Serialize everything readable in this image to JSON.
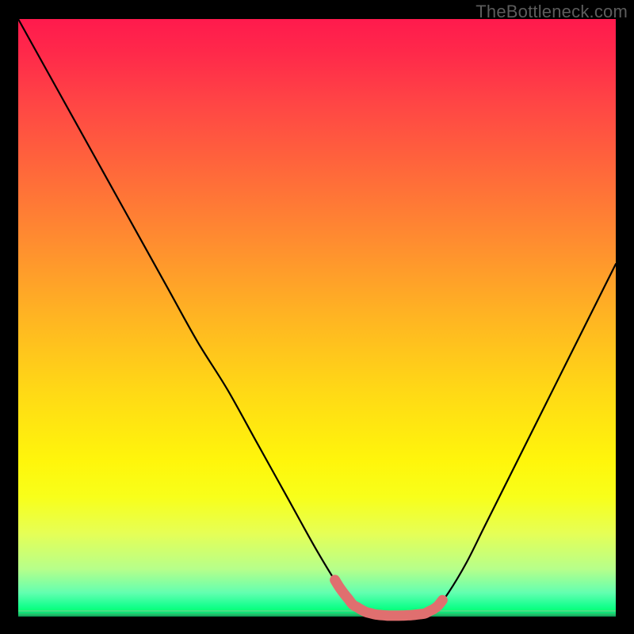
{
  "watermark": "TheBottleneck.com",
  "colors": {
    "frame": "#000000",
    "curve": "#000000",
    "highlight": "#e06f6f",
    "gradient_top": "#ff1a4d",
    "gradient_bottom": "#009e55"
  },
  "chart_data": {
    "type": "line",
    "title": "",
    "xlabel": "",
    "ylabel": "",
    "xlim": [
      0,
      100
    ],
    "ylim": [
      0,
      100
    ],
    "grid": false,
    "legend": false,
    "series": [
      {
        "name": "bottleneck-curve",
        "x": [
          0,
          5,
          10,
          15,
          20,
          25,
          30,
          35,
          40,
          45,
          50,
          54,
          56,
          58,
          60,
          62,
          64,
          66,
          68,
          70,
          72,
          75,
          78,
          82,
          86,
          90,
          94,
          98,
          100
        ],
        "values": [
          100,
          91,
          82,
          73,
          64,
          55,
          46,
          38,
          29,
          20,
          11,
          4.5,
          2.0,
          0.8,
          0.3,
          0.15,
          0.15,
          0.25,
          0.5,
          1.5,
          4,
          9,
          15,
          23,
          31,
          39,
          47,
          55,
          59
        ]
      }
    ],
    "highlight_range_x": [
      53,
      71
    ],
    "annotations": []
  }
}
